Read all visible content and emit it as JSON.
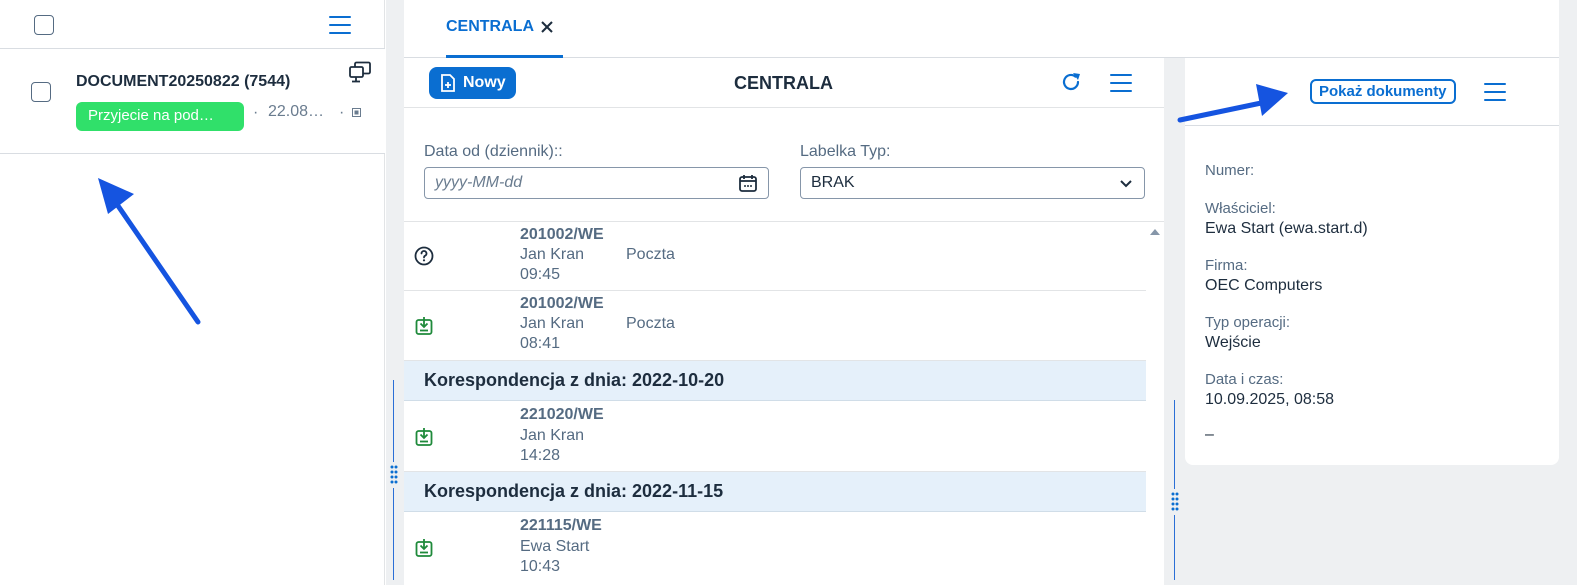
{
  "left": {
    "document_title": "DOCUMENT20250822 (7544)",
    "status_badge": "Przyjecie na pod…",
    "date": "22.08…",
    "separator": "·"
  },
  "tabs": [
    {
      "label": "CENTRALA"
    }
  ],
  "middle": {
    "new_button_label": "Nowy",
    "title": "CENTRALA",
    "filter": {
      "date_label": "Data od (dziennik)::",
      "date_placeholder": "yyyy-MM-dd",
      "type_label": "Labelka Typ:",
      "type_value": "BRAK"
    },
    "rows": [
      {
        "id": "201002/WE",
        "person": "Jan Kran",
        "time": "09:45",
        "channel": "Poczta",
        "icon": "question-circle-icon"
      },
      {
        "id": "201002/WE",
        "person": "Jan Kran",
        "time": "08:41",
        "channel": "Poczta",
        "icon": "inbox-download-icon"
      }
    ],
    "groups": [
      {
        "label": "Korespondencja z dnia: 2022-10-20",
        "rows": [
          {
            "id": "221020/WE",
            "person": "Jan Kran",
            "time": "14:28",
            "icon": "inbox-download-icon"
          }
        ]
      },
      {
        "label": "Korespondencja z dnia: 2022-11-15",
        "rows": [
          {
            "id": "221115/WE",
            "person": "Ewa Start",
            "time": "10:43",
            "icon": "inbox-download-icon"
          }
        ]
      }
    ]
  },
  "right": {
    "show_docs_label": "Pokaż dokumenty",
    "fields": [
      {
        "label": "Numer:",
        "value": ""
      },
      {
        "label": "Właściciel:",
        "value": "Ewa Start (ewa.start.d)"
      },
      {
        "label": "Firma:",
        "value": "OEC Computers"
      },
      {
        "label": "Typ operacji:",
        "value": "Wejście"
      },
      {
        "label": "Data i czas:",
        "value": "10.09.2025, 08:58"
      }
    ],
    "trailing": "–"
  },
  "colors": {
    "accent": "#0a6ed1",
    "badge_green": "#30e06a",
    "group_bg": "#e5f0fa",
    "annotation_arrow": "#1554e0"
  }
}
